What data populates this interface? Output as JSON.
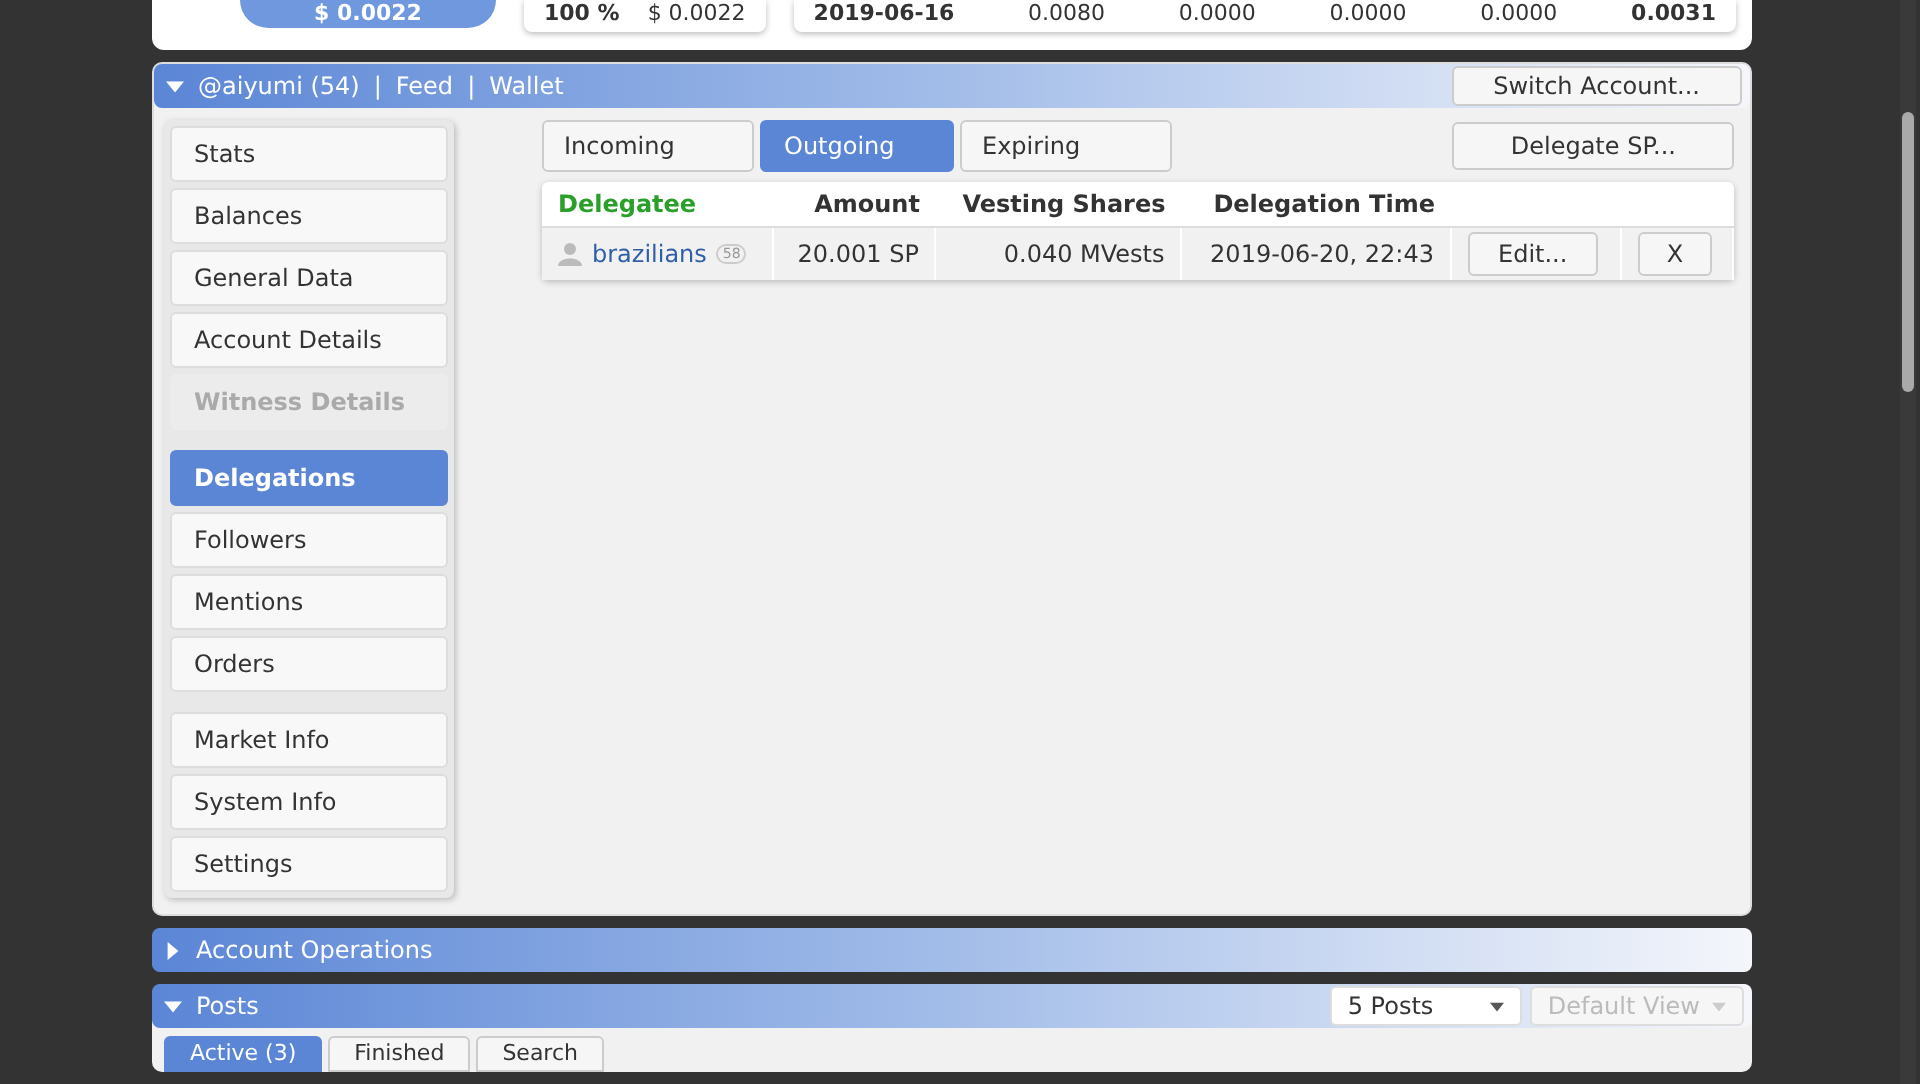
{
  "summary": {
    "circle_value": "$ 0.0022",
    "left_cells": [
      "100 %",
      "$ 0.0022"
    ],
    "right_cells": [
      "2019-06-16",
      "0.0080",
      "0.0000",
      "0.0000",
      "0.0000",
      "0.0031"
    ]
  },
  "account_panel": {
    "expanded": true,
    "title_parts": [
      "@aiyumi (54)",
      "|",
      "Feed",
      "|",
      "Wallet"
    ],
    "switch_button": "Switch Account...",
    "sidebar_groups": [
      [
        {
          "label": "Stats",
          "selected": false,
          "disabled": false
        },
        {
          "label": "Balances",
          "selected": false,
          "disabled": false
        },
        {
          "label": "General Data",
          "selected": false,
          "disabled": false
        },
        {
          "label": "Account Details",
          "selected": false,
          "disabled": false
        },
        {
          "label": "Witness Details",
          "selected": false,
          "disabled": true
        }
      ],
      [
        {
          "label": "Delegations",
          "selected": true,
          "disabled": false
        },
        {
          "label": "Followers",
          "selected": false,
          "disabled": false
        },
        {
          "label": "Mentions",
          "selected": false,
          "disabled": false
        },
        {
          "label": "Orders",
          "selected": false,
          "disabled": false
        }
      ],
      [
        {
          "label": "Market Info",
          "selected": false,
          "disabled": false
        },
        {
          "label": "System Info",
          "selected": false,
          "disabled": false
        },
        {
          "label": "Settings",
          "selected": false,
          "disabled": false
        }
      ]
    ],
    "tabs": [
      {
        "label": "Incoming",
        "selected": false
      },
      {
        "label": "Outgoing",
        "selected": true
      },
      {
        "label": "Expiring",
        "selected": false
      }
    ],
    "delegate_button": "Delegate SP...",
    "table": {
      "columns": [
        {
          "label": "Delegatee",
          "sorted": true
        },
        {
          "label": "Amount",
          "sorted": false
        },
        {
          "label": "Vesting Shares",
          "sorted": false
        },
        {
          "label": "Delegation Time",
          "sorted": false
        }
      ],
      "rows": [
        {
          "delegatee": "brazilians",
          "reputation": "58",
          "amount": "20.001 SP",
          "vesting_shares": "0.040 MVests",
          "time": "2019-06-20, 22:43",
          "actions": [
            "Edit...",
            "X"
          ]
        }
      ]
    }
  },
  "sections": [
    {
      "title": "Account Operations",
      "expanded": false
    },
    {
      "title": "Posts",
      "expanded": true,
      "dropdowns": [
        {
          "value": "5 Posts",
          "disabled": false
        },
        {
          "value": "Default View",
          "disabled": true
        }
      ],
      "tabs": [
        {
          "label": "Active (3)",
          "selected": true
        },
        {
          "label": "Finished",
          "selected": false
        },
        {
          "label": "Search",
          "selected": false
        }
      ]
    }
  ]
}
